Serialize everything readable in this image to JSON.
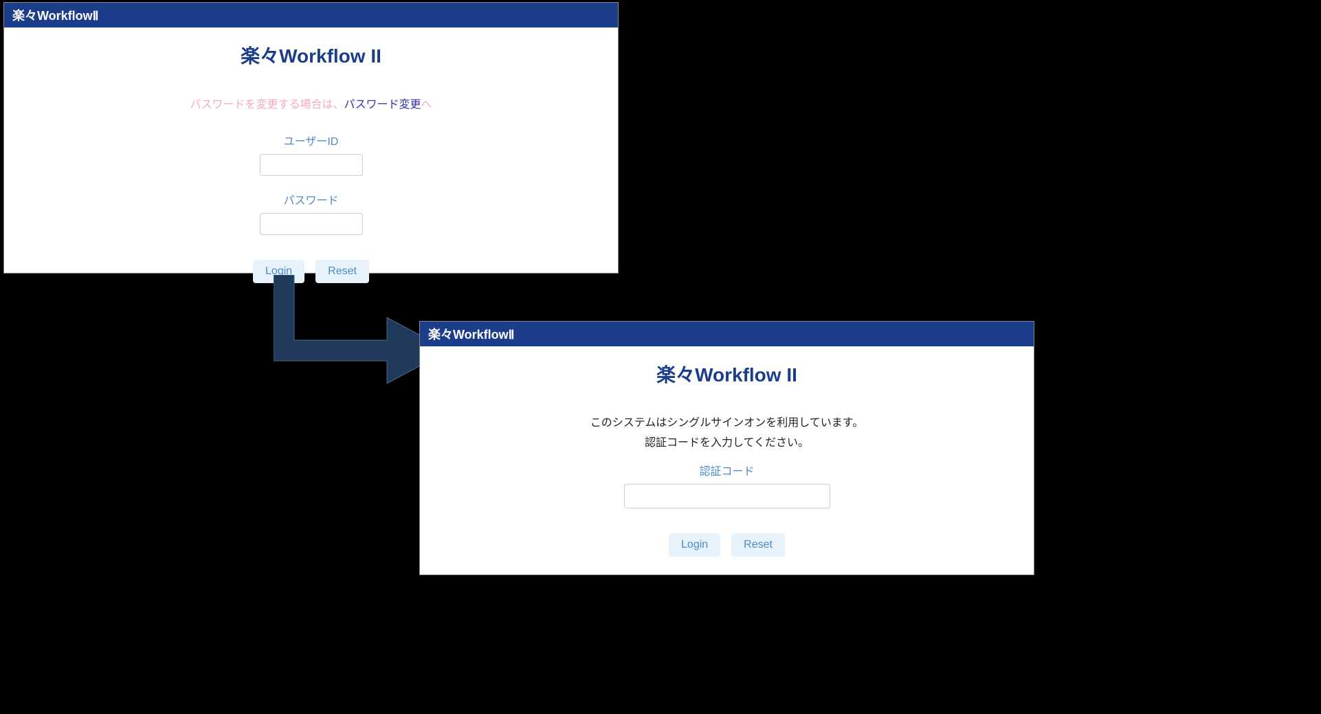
{
  "logo_text": "楽々WorkflowⅡ",
  "window1": {
    "title": "楽々Workflow II",
    "hint_prefix": "パスワードを変更する場合は、",
    "hint_link": "パスワード変更",
    "hint_suffix": "へ",
    "user_id_label": "ユーザーID",
    "password_label": "パスワード",
    "login_label": "Login",
    "reset_label": "Reset"
  },
  "window2": {
    "title": "楽々Workflow II",
    "sso_line1": "このシステムはシングルサインオンを利用しています。",
    "sso_line2": "認証コードを入力してください。",
    "auth_code_label": "認証コード",
    "login_label": "Login",
    "reset_label": "Reset"
  }
}
